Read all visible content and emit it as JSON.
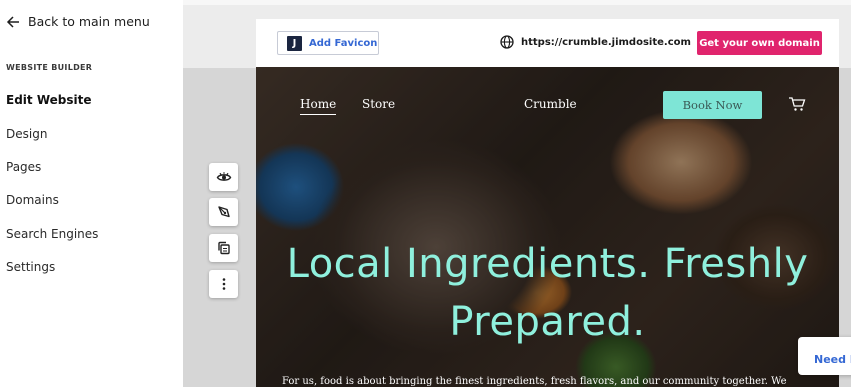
{
  "sidebar": {
    "back_label": "Back to main menu",
    "section_title": "WEBSITE BUILDER",
    "items": [
      {
        "label": "Edit Website"
      },
      {
        "label": "Design"
      },
      {
        "label": "Pages"
      },
      {
        "label": "Domains"
      },
      {
        "label": "Search Engines"
      },
      {
        "label": "Settings"
      }
    ]
  },
  "site_bar": {
    "favicon_logo": "J",
    "favicon_label": "Add Favicon",
    "url": "https://crumble.jimdosite.com",
    "domain_button": "Get your own domain"
  },
  "hero": {
    "nav": [
      {
        "label": "Home"
      },
      {
        "label": "Store"
      }
    ],
    "brand": "Crumble",
    "book_button": "Book Now",
    "title_line1": "Local Ingredients. Freshly",
    "title_line2": "Prepared.",
    "body": "For us, food is about bringing the finest ingredients, fresh flavors, and our community together. We"
  },
  "tools": [
    "eye-icon",
    "paint-icon",
    "copy-icon",
    "more-icon"
  ],
  "help": {
    "label": "Need help?"
  },
  "colors": {
    "accent_pink": "#e0246d",
    "link_blue": "#3568d4",
    "mint": "#7ee5d6",
    "title_mint": "#8ff0dd"
  }
}
